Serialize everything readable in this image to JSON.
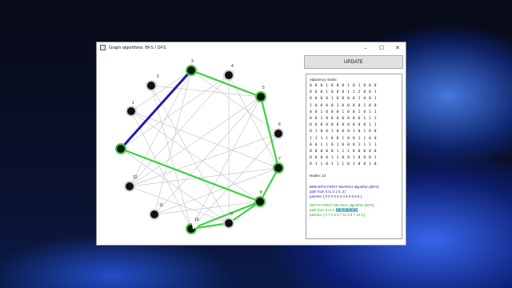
{
  "window": {
    "title": "Graph algorithms: BFS / DFS",
    "minimize_icon": "minimize-icon",
    "maximize_icon": "maximize-icon",
    "close_icon": "close-icon"
  },
  "controls": {
    "update_label": "UPDATE"
  },
  "panel": {
    "matrix_title": "Adjacency matrix:",
    "matrix_rows": [
      "0 0 0 1 0 0 0 1 0 1 0 0 0",
      "0 0 0 1 0 0 0 1 1 2 0 0 1",
      "0 0 0 0 1 0 0 0 0 1 0 0 1",
      "1 0 0 0 0 1 0 0 0 0 1 0 0",
      "0 0 1 0 0 0 1 0 0 1 0 1 1",
      "0 0 1 0 0 0 0 0 0 0 1 1 1",
      "0 0 0 0 0 0 0 0 0 0 0 1 1",
      "0 1 0 0 1 0 0 0 1 0 1 0 0",
      "1 1 1 1 0 0 1 0 0 1 1 0 0",
      "0 0 1 1 0 1 0 0 0 1 1 1 1",
      "0 0 0 0 0 1 1 1 0 0 0 0 0",
      "0 0 0 0 1 1 0 0 1 0 0 0 1",
      "0 1 1 0 1 1 1 0 1 0 0 1 0"
    ],
    "nodes_count": "Nodes: 13",
    "bfs_title": "BREADTH FIRST SEARCH algorithm (BFS):",
    "bfs_path": "path from 0 to 3: [ 0, 3 ]",
    "bfs_parents": "parents: [ 0 0 0 0 0 3 4 8 0 8 8 6 ]",
    "dfs_title": "DEPTH FIRST SEARCH algorithm (DFS):",
    "dfs_path_prefix": "path from 0 to 3: ",
    "dfs_path_highlight": "[ 0, 7, 9, 8, 3 ]",
    "dfs_parents": "parents: [ 0 7 4 8 6 7 11 0 9 7 10 5 ]"
  },
  "graph": {
    "labels": [
      "1",
      "2",
      "3",
      "4",
      "5",
      "6",
      "7",
      "8",
      "9",
      "10",
      "11",
      "12"
    ],
    "colors": {
      "bfs_edge": "#1f1fb0",
      "dfs_edge": "#3ed03e",
      "gray_edge": "#c8c8c8",
      "node_fill": "#111111",
      "node_ring": "#d5d5d5"
    }
  }
}
